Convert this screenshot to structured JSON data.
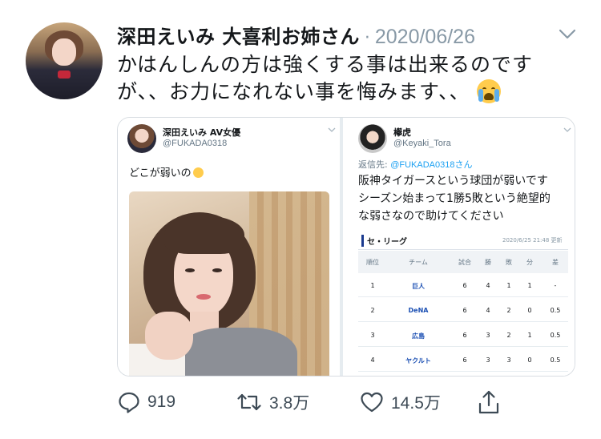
{
  "tweet": {
    "display_name": "深田えいみ 大喜利お姉さん",
    "separator": "·",
    "date": "2020/06/26",
    "text_lines": [
      "かはんしんの方は強くする事は出来るのです",
      "が、、お力になれない事を悔みます、、"
    ],
    "emoji": "loudly-crying-face-emoji"
  },
  "quoted_left": {
    "name": "深田えいみ AV女優",
    "handle": "@FUKADA0318",
    "text": "どこが弱いの",
    "emoji": "relieved-face-emoji"
  },
  "quoted_right": {
    "name": "欅虎",
    "handle": "@Keyaki_Tora",
    "reply_prefix": "返信先: ",
    "reply_to": "@FUKADA0318さん",
    "text_lines": [
      "阪神タイガースという球団が弱いです",
      "シーズン始まって1勝5敗という絶望的",
      "な弱さなので助けてください"
    ],
    "standings": {
      "title": "セ・リーグ",
      "updated": "2020/6/25 21:48 更新",
      "headers": [
        "順位",
        "チーム",
        "試合",
        "勝",
        "敗",
        "分",
        "差"
      ],
      "rows": [
        [
          "1",
          "巨人",
          "6",
          "4",
          "1",
          "1",
          "-"
        ],
        [
          "2",
          "DeNA",
          "6",
          "4",
          "2",
          "0",
          "0.5"
        ],
        [
          "3",
          "広島",
          "6",
          "3",
          "2",
          "1",
          "0.5"
        ],
        [
          "4",
          "ヤクルト",
          "6",
          "3",
          "3",
          "0",
          "0.5"
        ]
      ]
    }
  },
  "actions": {
    "replies": "919",
    "retweets": "3.8万",
    "likes": "14.5万"
  },
  "colors": {
    "text": "#14171a",
    "muted": "#8899a6",
    "link": "#1da1f2",
    "team_link": "#1b4fb3",
    "border": "#d8dde2"
  }
}
